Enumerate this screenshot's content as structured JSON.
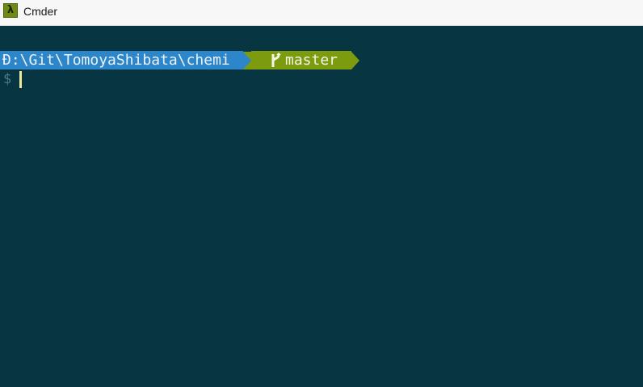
{
  "window": {
    "title": "Cmder",
    "icon_glyph": "λ",
    "icon_name": "lambda-icon"
  },
  "prompt": {
    "path": "Ð:\\Git\\TomoyaShibata\\chemi",
    "branch": "master",
    "branch_icon": "git-branch-icon",
    "symbol": "$"
  },
  "colors": {
    "background": "#073642",
    "path_bg": "#2d86c9",
    "branch_bg": "#7d9b0f",
    "cursor": "#f1e79a"
  }
}
